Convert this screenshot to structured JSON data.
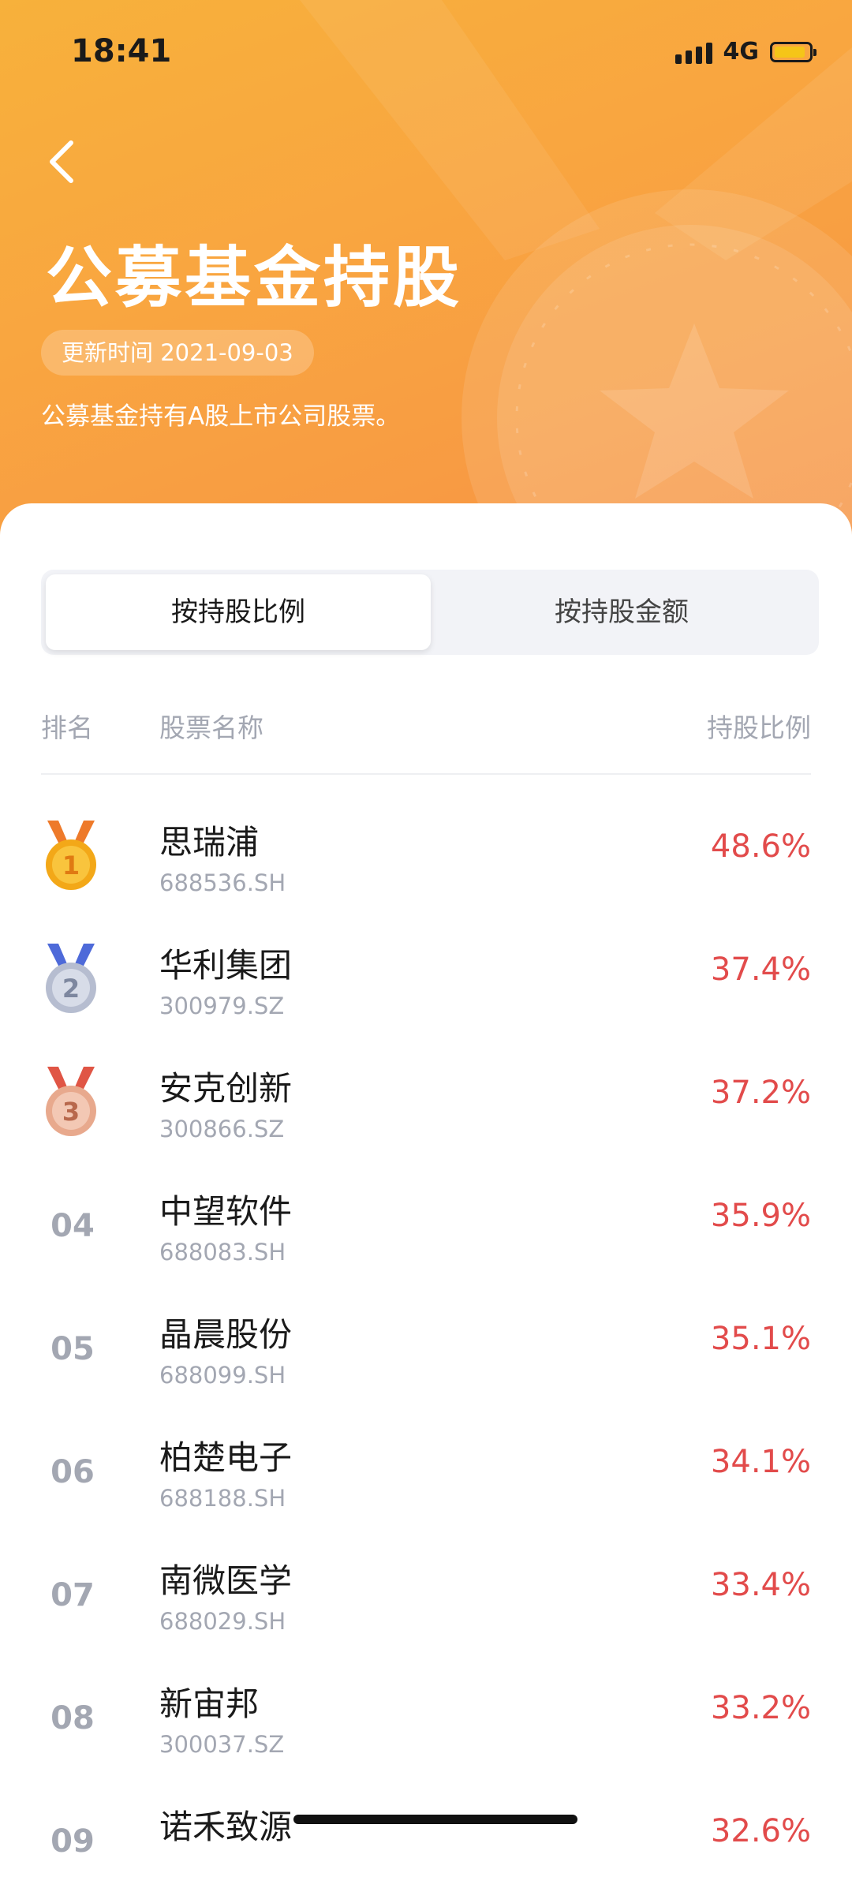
{
  "status_bar": {
    "time": "18:41",
    "network": "4G"
  },
  "header": {
    "title": "公募基金持股",
    "update_time": "更新时间 2021-09-03",
    "subtitle": "公募基金持有A股上市公司股票。"
  },
  "tabs": [
    {
      "label": "按持股比例",
      "active": true
    },
    {
      "label": "按持股金额",
      "active": false
    }
  ],
  "table_header": {
    "rank": "排名",
    "name": "股票名称",
    "ratio": "持股比例"
  },
  "rows": [
    {
      "rank": "1",
      "medal": "gold-medal",
      "name": "思瑞浦",
      "code": "688536.SH",
      "ratio": "48.6%"
    },
    {
      "rank": "2",
      "medal": "silver-medal",
      "name": "华利集团",
      "code": "300979.SZ",
      "ratio": "37.4%"
    },
    {
      "rank": "3",
      "medal": "bronze-medal",
      "name": "安克创新",
      "code": "300866.SZ",
      "ratio": "37.2%"
    },
    {
      "rank": "04",
      "name": "中望软件",
      "code": "688083.SH",
      "ratio": "35.9%"
    },
    {
      "rank": "05",
      "name": "晶晨股份",
      "code": "688099.SH",
      "ratio": "35.1%"
    },
    {
      "rank": "06",
      "name": "柏楚电子",
      "code": "688188.SH",
      "ratio": "34.1%"
    },
    {
      "rank": "07",
      "name": "南微医学",
      "code": "688029.SH",
      "ratio": "33.4%"
    },
    {
      "rank": "08",
      "name": "新宙邦",
      "code": "300037.SZ",
      "ratio": "33.2%"
    },
    {
      "rank": "09",
      "name": "诺禾致源",
      "code": "",
      "ratio": "32.6%"
    }
  ],
  "colors": {
    "accent_red": "#e24b4b",
    "header_orange": "#f9a640",
    "gold": "#f3a818",
    "silver": "#b6bdd0",
    "bronze": "#e8a98d"
  }
}
